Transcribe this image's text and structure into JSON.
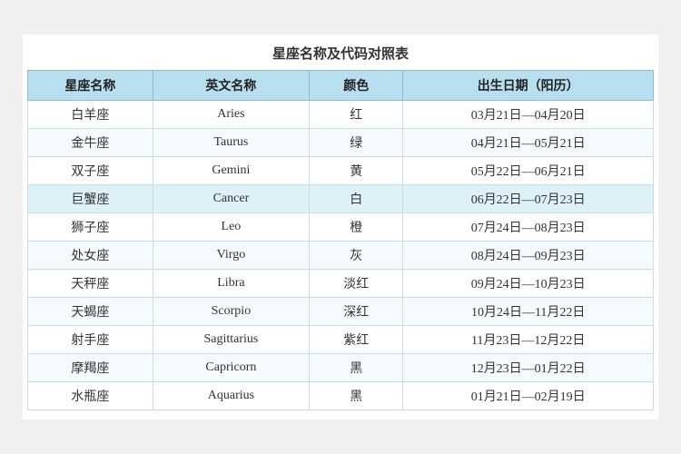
{
  "title": "星座名称及代码对照表",
  "table": {
    "headers": [
      "星座名称",
      "英文名称",
      "颜色",
      "出生日期（阳历）"
    ],
    "rows": [
      {
        "name": "白羊座",
        "en": "Aries",
        "color": "红",
        "date": "03月21日—04月20日"
      },
      {
        "name": "金牛座",
        "en": "Taurus",
        "color": "绿",
        "date": "04月21日—05月21日"
      },
      {
        "name": "双子座",
        "en": "Gemini",
        "color": "黄",
        "date": "05月22日—06月21日"
      },
      {
        "name": "巨蟹座",
        "en": "Cancer",
        "color": "白",
        "date": "06月22日—07月23日"
      },
      {
        "name": "狮子座",
        "en": "Leo",
        "color": "橙",
        "date": "07月24日—08月23日"
      },
      {
        "name": "处女座",
        "en": "Virgo",
        "color": "灰",
        "date": "08月24日—09月23日"
      },
      {
        "name": "天秤座",
        "en": "Libra",
        "color": "淡红",
        "date": "09月24日—10月23日"
      },
      {
        "name": "天蝎座",
        "en": "Scorpio",
        "color": "深红",
        "date": "10月24日—11月22日"
      },
      {
        "name": "射手座",
        "en": "Sagittarius",
        "color": "紫红",
        "date": "11月23日—12月22日"
      },
      {
        "name": "摩羯座",
        "en": "Capricorn",
        "color": "黑",
        "date": "12月23日—01月22日"
      },
      {
        "name": "水瓶座",
        "en": "Aquarius",
        "color": "黑",
        "date": "01月21日—02月19日"
      }
    ]
  }
}
